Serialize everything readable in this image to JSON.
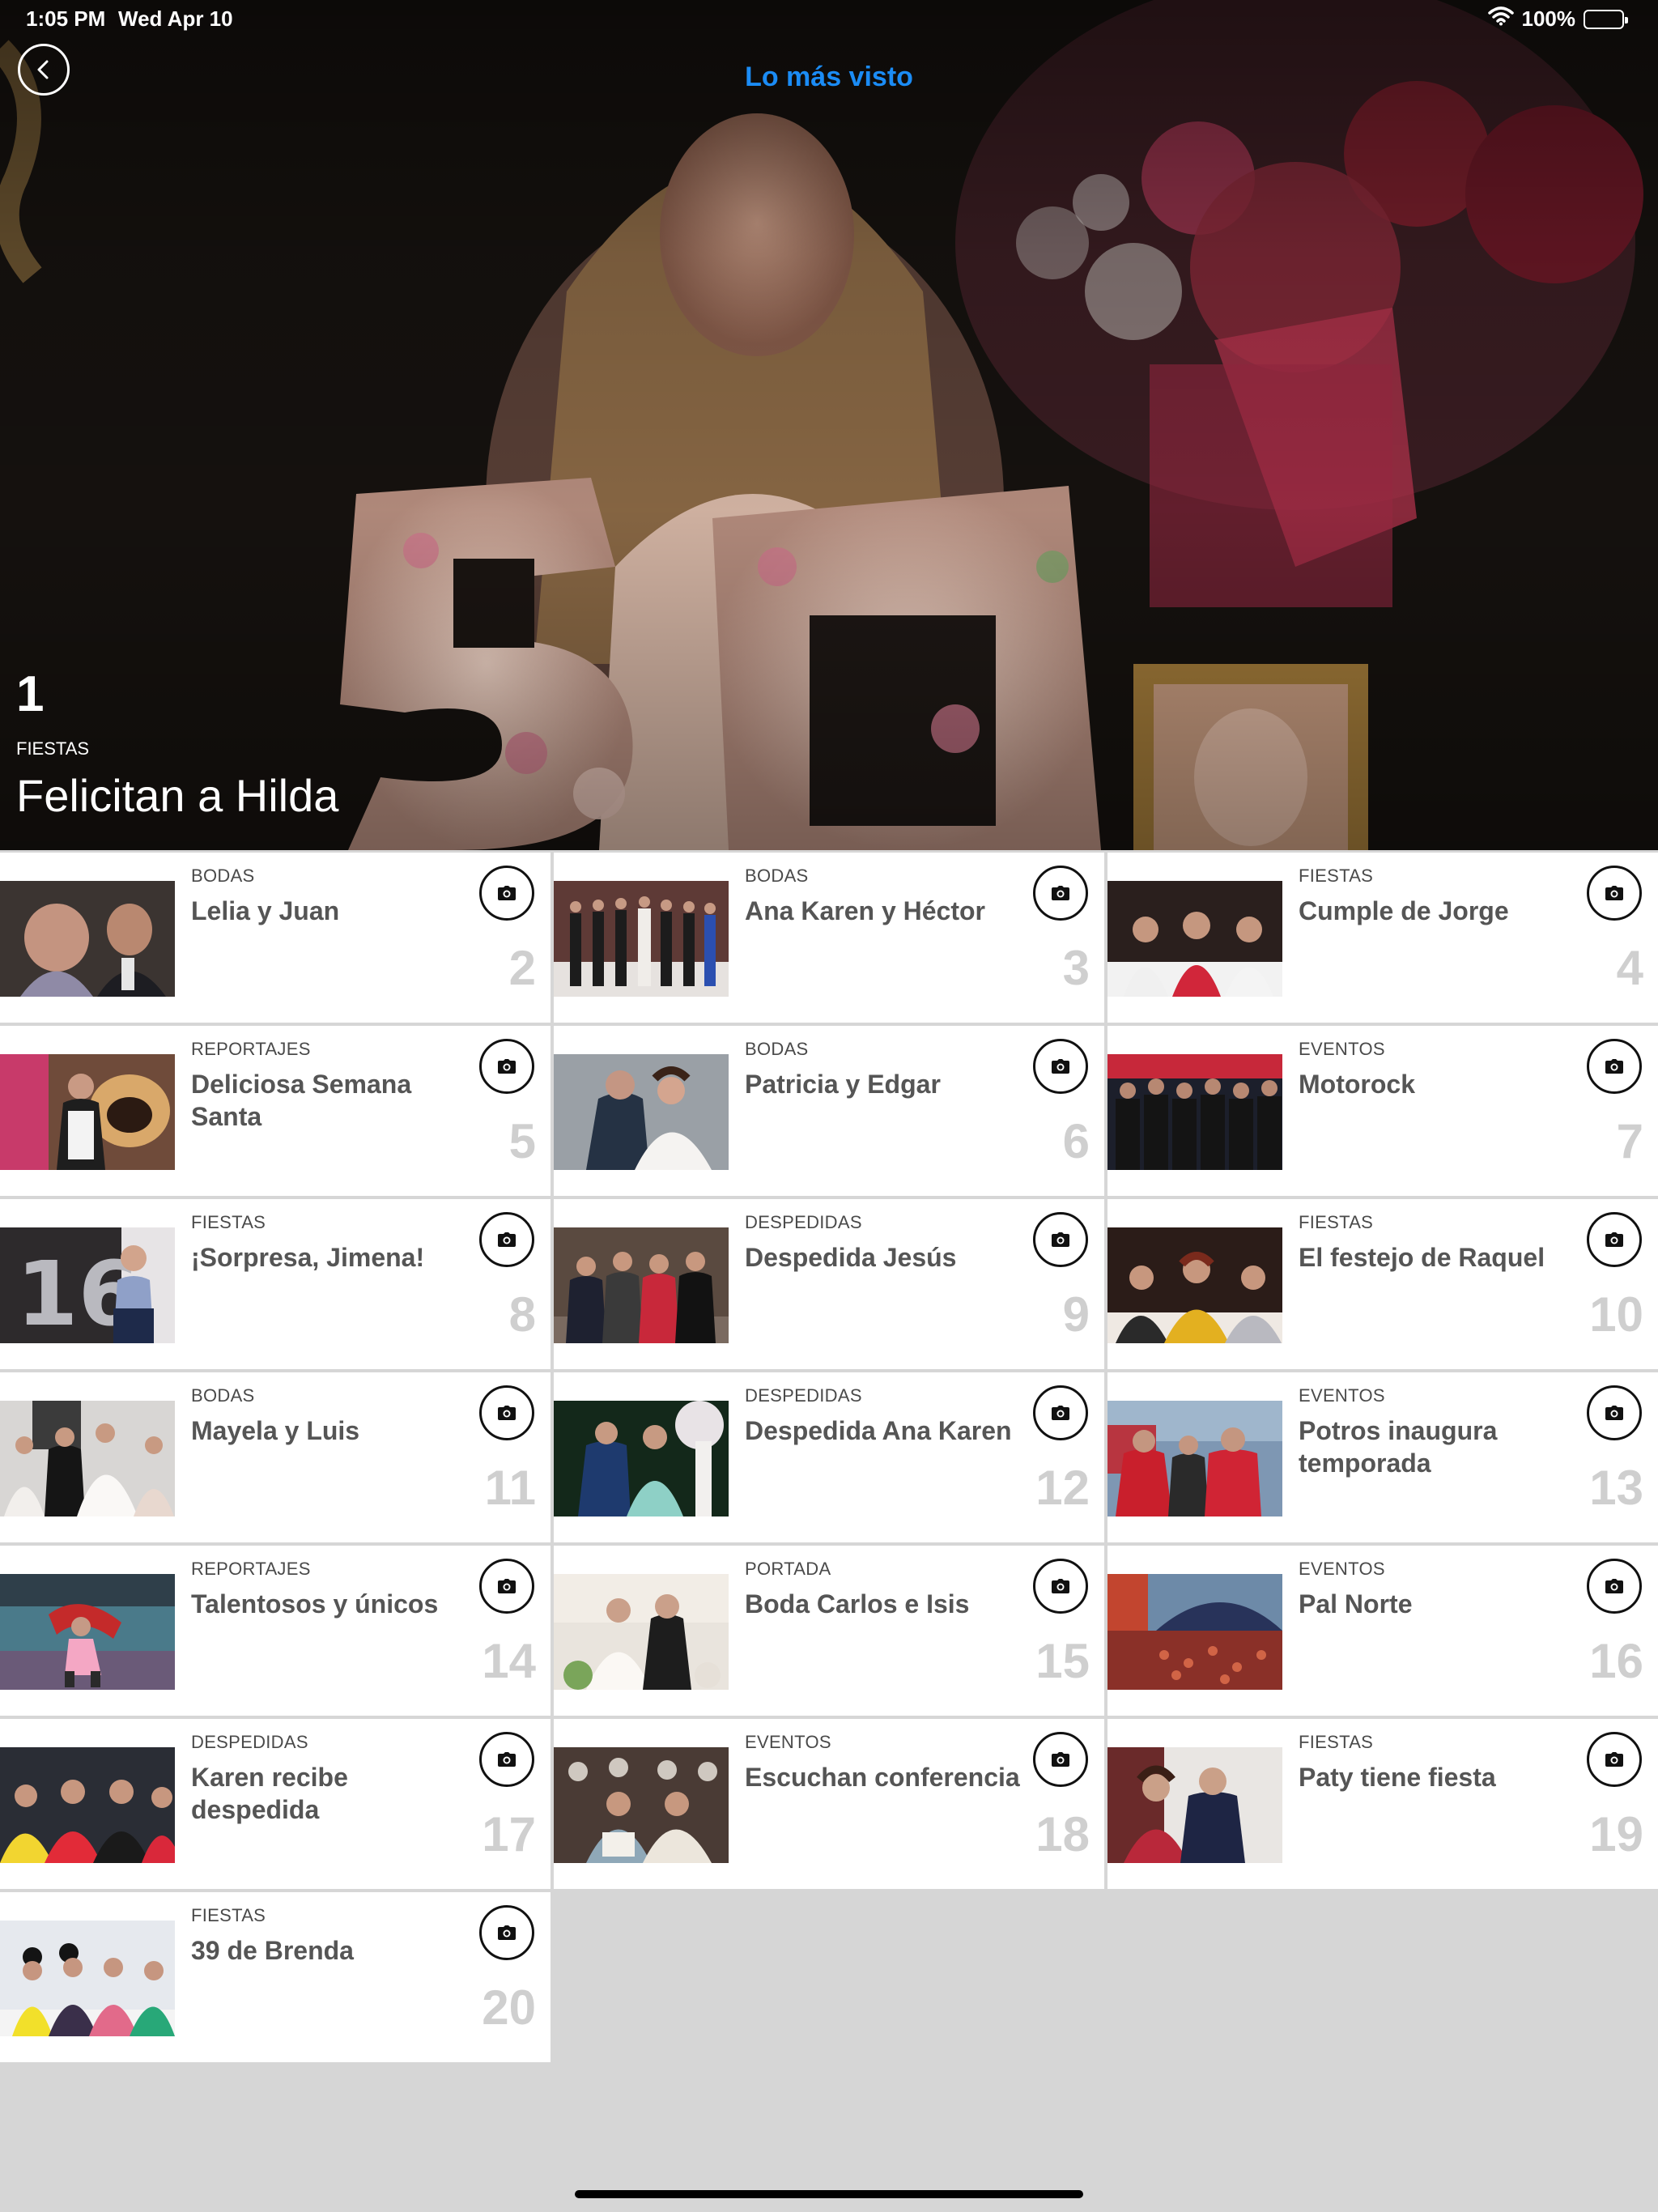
{
  "status_bar": {
    "time": "1:05 PM",
    "date": "Wed Apr 10",
    "battery": "100%"
  },
  "nav": {
    "title": "Lo más visto",
    "title_color": "#1b8cf5"
  },
  "featured": {
    "rank": "1",
    "category": "FIESTAS",
    "title": "Felicitan a Hilda"
  },
  "items": [
    {
      "rank": "2",
      "category": "BODAS",
      "title": "Lelia y Juan"
    },
    {
      "rank": "3",
      "category": "BODAS",
      "title": "Ana Karen y Héctor"
    },
    {
      "rank": "4",
      "category": "FIESTAS",
      "title": "Cumple de Jorge"
    },
    {
      "rank": "5",
      "category": "REPORTAJES",
      "title": "Deliciosa Semana Santa"
    },
    {
      "rank": "6",
      "category": "BODAS",
      "title": "Patricia y Edgar"
    },
    {
      "rank": "7",
      "category": "EVENTOS",
      "title": "Motorock"
    },
    {
      "rank": "8",
      "category": "FIESTAS",
      "title": "¡Sorpresa, Jimena!"
    },
    {
      "rank": "9",
      "category": "DESPEDIDAS",
      "title": "Despedida Jesús"
    },
    {
      "rank": "10",
      "category": "FIESTAS",
      "title": "El festejo de Raquel"
    },
    {
      "rank": "11",
      "category": "BODAS",
      "title": "Mayela y Luis"
    },
    {
      "rank": "12",
      "category": "DESPEDIDAS",
      "title": "Despedida Ana Karen"
    },
    {
      "rank": "13",
      "category": "EVENTOS",
      "title": "Potros inaugura temporada"
    },
    {
      "rank": "14",
      "category": "REPORTAJES",
      "title": "Talentosos y únicos"
    },
    {
      "rank": "15",
      "category": "PORTADA",
      "title": "Boda Carlos e Isis"
    },
    {
      "rank": "16",
      "category": "EVENTOS",
      "title": "Pal Norte"
    },
    {
      "rank": "17",
      "category": "DESPEDIDAS",
      "title": "Karen recibe despedida"
    },
    {
      "rank": "18",
      "category": "EVENTOS",
      "title": "Escuchan conferencia"
    },
    {
      "rank": "19",
      "category": "FIESTAS",
      "title": "Paty tiene fiesta"
    },
    {
      "rank": "20",
      "category": "FIESTAS",
      "title": "39 de Brenda"
    }
  ],
  "icons": {
    "back": "chevron-left-icon",
    "gallery": "camera-icon",
    "wifi": "wifi-icon",
    "battery": "battery-icon"
  }
}
